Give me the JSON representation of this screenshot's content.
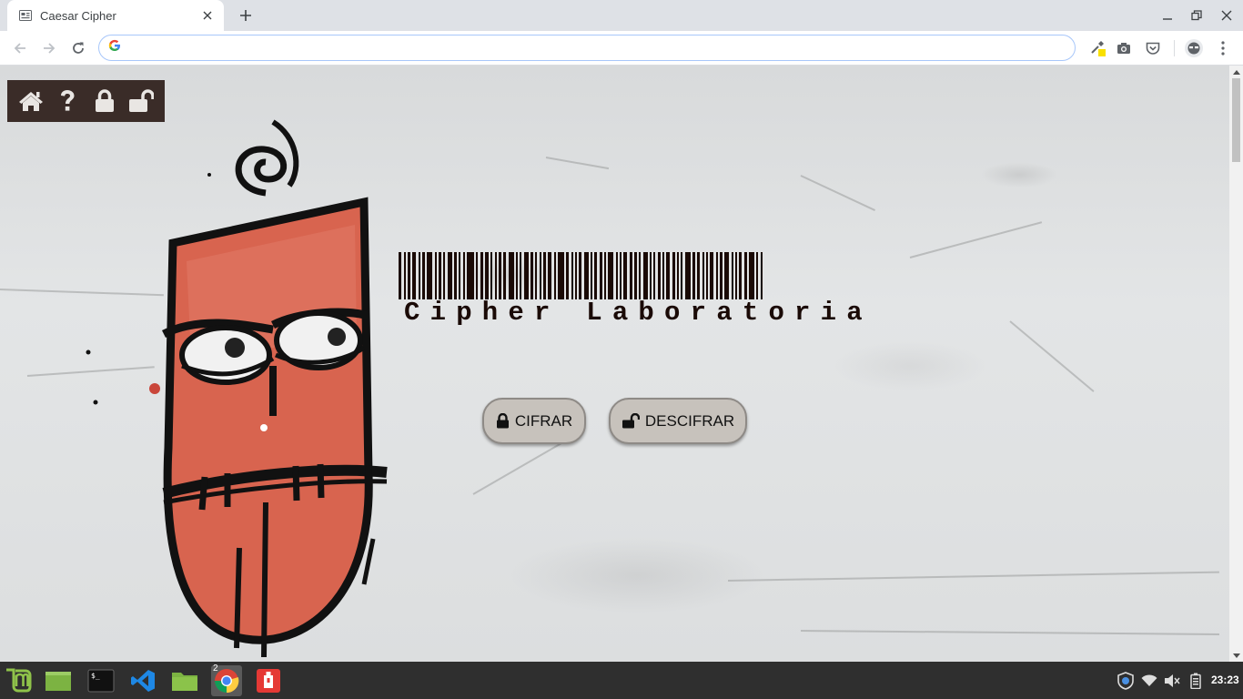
{
  "browser": {
    "tab_title": "Caesar Cipher",
    "address_value": "",
    "address_placeholder": ""
  },
  "site": {
    "nav": [
      {
        "name": "home-icon"
      },
      {
        "name": "help-icon"
      },
      {
        "name": "lock-icon"
      },
      {
        "name": "unlock-icon"
      }
    ],
    "logo_text": "Cipher Laboratoria",
    "buttons": {
      "encrypt_label": "CIFRAR",
      "decrypt_label": "DESCIFRAR"
    }
  },
  "taskbar": {
    "chrome_window_count": "2",
    "clock": "23:23"
  },
  "colors": {
    "nav_bg": "#3a2c28",
    "logo": "#1a0a06",
    "button_bg": "#c7c2bc",
    "mural_red": "#d8644f"
  }
}
